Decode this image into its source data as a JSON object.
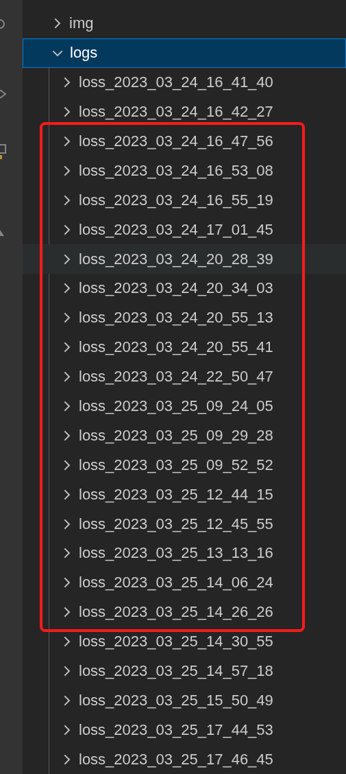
{
  "explorer": {
    "items": [
      {
        "label": "img",
        "expanded": false,
        "selected": false
      },
      {
        "label": "logs",
        "expanded": true,
        "selected": true,
        "groups": [
          {
            "highlighted": false,
            "children": [
              {
                "label": "loss_2023_03_24_16_41_40",
                "expanded": false,
                "hovered": false
              },
              {
                "label": "loss_2023_03_24_16_42_27",
                "expanded": false,
                "hovered": false
              }
            ]
          },
          {
            "highlighted": true,
            "children": [
              {
                "label": "loss_2023_03_24_16_47_56",
                "expanded": false,
                "hovered": false
              },
              {
                "label": "loss_2023_03_24_16_53_08",
                "expanded": false,
                "hovered": false
              },
              {
                "label": "loss_2023_03_24_16_55_19",
                "expanded": false,
                "hovered": false
              },
              {
                "label": "loss_2023_03_24_17_01_45",
                "expanded": false,
                "hovered": false
              },
              {
                "label": "loss_2023_03_24_20_28_39",
                "expanded": false,
                "hovered": true
              },
              {
                "label": "loss_2023_03_24_20_34_03",
                "expanded": false,
                "hovered": false
              },
              {
                "label": "loss_2023_03_24_20_55_13",
                "expanded": false,
                "hovered": false
              },
              {
                "label": "loss_2023_03_24_20_55_41",
                "expanded": false,
                "hovered": false
              },
              {
                "label": "loss_2023_03_24_22_50_47",
                "expanded": false,
                "hovered": false
              },
              {
                "label": "loss_2023_03_25_09_24_05",
                "expanded": false,
                "hovered": false
              },
              {
                "label": "loss_2023_03_25_09_29_28",
                "expanded": false,
                "hovered": false
              },
              {
                "label": "loss_2023_03_25_09_52_52",
                "expanded": false,
                "hovered": false
              },
              {
                "label": "loss_2023_03_25_12_44_15",
                "expanded": false,
                "hovered": false
              },
              {
                "label": "loss_2023_03_25_12_45_55",
                "expanded": false,
                "hovered": false
              },
              {
                "label": "loss_2023_03_25_13_13_16",
                "expanded": false,
                "hovered": false
              },
              {
                "label": "loss_2023_03_25_14_06_24",
                "expanded": false,
                "hovered": false
              },
              {
                "label": "loss_2023_03_25_14_26_26",
                "expanded": false,
                "hovered": false
              }
            ]
          },
          {
            "highlighted": false,
            "children": [
              {
                "label": "loss_2023_03_25_14_30_55",
                "expanded": false,
                "hovered": false
              },
              {
                "label": "loss_2023_03_25_14_57_18",
                "expanded": false,
                "hovered": false
              },
              {
                "label": "loss_2023_03_25_15_50_49",
                "expanded": false,
                "hovered": false
              },
              {
                "label": "loss_2023_03_25_17_44_53",
                "expanded": false,
                "hovered": false
              },
              {
                "label": "loss_2023_03_25_17_46_45",
                "expanded": false,
                "hovered": false
              }
            ]
          }
        ]
      }
    ]
  }
}
